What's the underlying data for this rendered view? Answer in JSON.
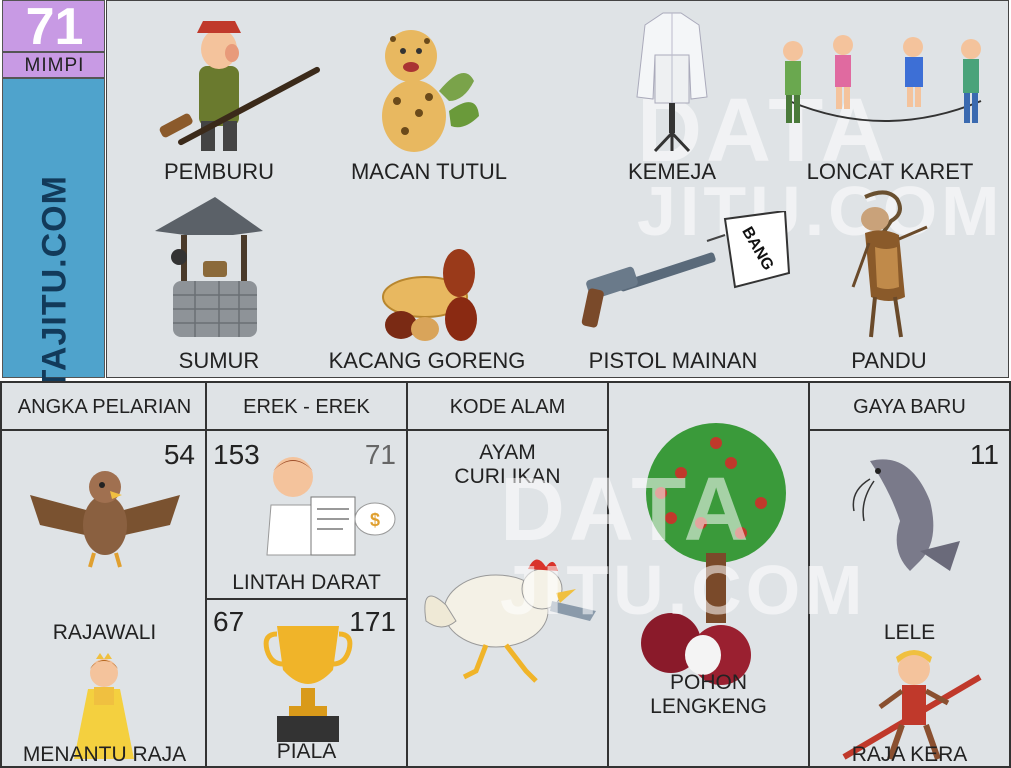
{
  "header": {
    "number": "71",
    "mimpi": "MIMPI",
    "site": "DATAJITU.COM"
  },
  "items": {
    "pemburu": "PEMBURU",
    "macan_tutul": "MACAN TUTUL",
    "kemeja": "KEMEJA",
    "loncat_karet": "LONCAT KARET",
    "sumur": "SUMUR",
    "kacang_goreng": "KACANG GORENG",
    "pistol_mainan": "PISTOL MAINAN",
    "pandu": "PANDU"
  },
  "flag_text": "BANG",
  "watermark": {
    "line1": "DATA",
    "line2": "JITU.COM"
  },
  "table": {
    "angka_pelarian": {
      "header": "ANGKA PELARIAN",
      "number": "54",
      "label1": "RAJAWALI",
      "label2": "MENANTU RAJA"
    },
    "erek": {
      "header": "EREK - EREK",
      "top": {
        "left": "153",
        "right": "71",
        "label": "LINTAH DARAT"
      },
      "bottom": {
        "left": "67",
        "right": "171",
        "label": "PIALA"
      }
    },
    "kode_alam": {
      "header": "KODE ALAM",
      "line1": "AYAM",
      "line2": "CURI IKAN"
    },
    "pohon": {
      "line1": "POHON",
      "line2": "LENGKENG"
    },
    "gaya_baru": {
      "header": "GAYA BARU",
      "number": "11",
      "label1": "LELE",
      "label2": "RAJA KERA"
    }
  },
  "colors": {
    "purple": "#c89ae4",
    "blue": "#4fa3cc",
    "panel": "#dfe3e6"
  }
}
